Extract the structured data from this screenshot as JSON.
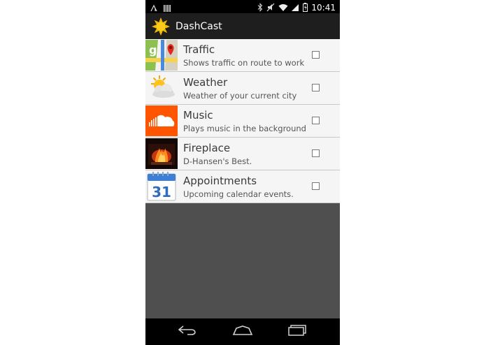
{
  "statusbar": {
    "time": "10:41",
    "icons": [
      "signal-warning-icon",
      "barcode-icon",
      "bluetooth-icon",
      "mute-icon",
      "wifi-icon",
      "cell-signal-icon",
      "battery-icon"
    ]
  },
  "app": {
    "title": "DashCast",
    "icon": "sun-icon"
  },
  "items": [
    {
      "title": "Traffic",
      "subtitle": "Shows traffic on route to work",
      "icon": "maps-icon",
      "checked": false
    },
    {
      "title": "Weather",
      "subtitle": "Weather of your current city",
      "icon": "weather-icon",
      "checked": false
    },
    {
      "title": "Music",
      "subtitle": "Plays music in the background",
      "icon": "soundcloud-icon",
      "checked": false
    },
    {
      "title": "Fireplace",
      "subtitle": "D-Hansen's Best.",
      "icon": "fireplace-icon",
      "checked": false
    },
    {
      "title": "Appointments",
      "subtitle": "Upcoming calendar events.",
      "icon": "calendar-icon",
      "calendar_day": "31",
      "checked": false
    }
  ],
  "navbar": {
    "buttons": [
      "back-icon",
      "home-icon",
      "recents-icon"
    ]
  },
  "colors": {
    "actionbar": "#1e1e1e",
    "list_background": "#f5f5f5",
    "empty_background": "#4f4f4f",
    "soundcloud": "#ff5500"
  }
}
